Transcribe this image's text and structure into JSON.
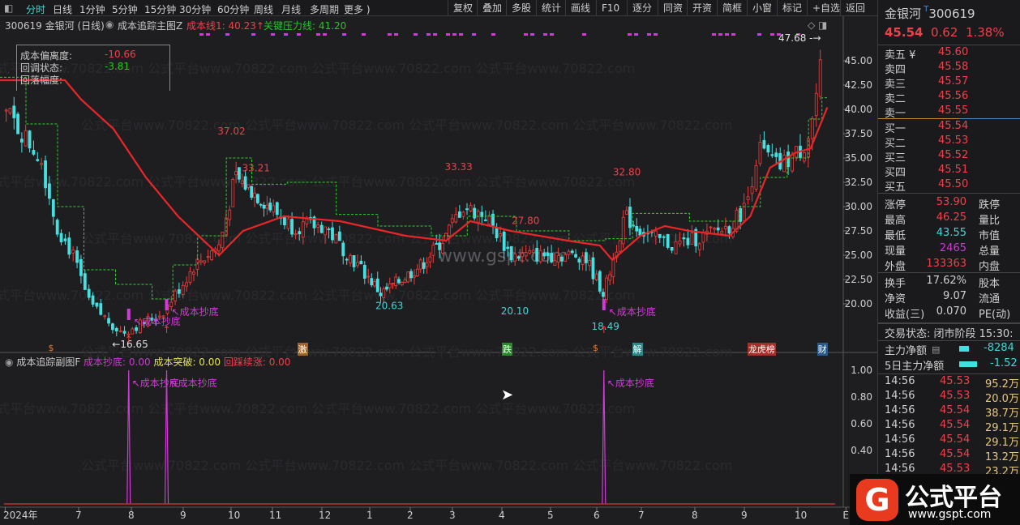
{
  "toolbar": {
    "periods": [
      "分时",
      "日线",
      "1分钟",
      "5分钟",
      "15分钟",
      "30分钟",
      "60分钟",
      "周线",
      "月线",
      "多周期",
      "更多 )"
    ],
    "buttons": [
      "复权",
      "叠加",
      "多股",
      "统计",
      "画线",
      "F10",
      "逐分",
      "同资",
      "开资",
      "简框",
      "小窗",
      "标记",
      "+自选",
      "返回"
    ]
  },
  "info": {
    "symbol": "300619 金银河 (日线)",
    "indicator": "成本追踪主图Z",
    "cost_line": "成本线1: 40.23↑",
    "key_line": "关键压力线: 41.20"
  },
  "legend": {
    "rows": [
      {
        "label": "成本偏离度:",
        "value": "-10.66"
      },
      {
        "label": "回调状态:",
        "value": "-3.81"
      },
      {
        "label": "回落幅度:",
        "value": ""
      }
    ]
  },
  "sub": {
    "title": "成本追踪副图F",
    "s1": "成本抄底: 0.00",
    "s2": "成本突破: 0.00",
    "s3": "回踩续涨: 0.00",
    "signal_label": "成本抄底"
  },
  "events": [
    {
      "m": 6.5,
      "t": "$",
      "c": "#e07a40",
      "bg": ""
    },
    {
      "m": 11.6,
      "t": "激",
      "c": "#fff",
      "bg": "#a0602a"
    },
    {
      "m": 16.1,
      "t": "跌",
      "c": "#fff",
      "bg": "#2a8a2a"
    },
    {
      "m": 18.0,
      "t": "$",
      "c": "#e07a40",
      "bg": ""
    },
    {
      "m": 18.9,
      "t": "解",
      "c": "#fff",
      "bg": "#2a8a8a"
    },
    {
      "m": 21.15,
      "t": "龙虎榜",
      "c": "#fff",
      "bg": "#a0302a"
    },
    {
      "m": 22.45,
      "t": "财",
      "c": "#fff",
      "bg": "#2a5a8a"
    }
  ],
  "chart_data": {
    "type": "candlestick",
    "x_unit": "months since 2024-01 (13 = Jan 2025)",
    "x_ticks": [
      {
        "m": 5.6,
        "label": "2024年"
      },
      {
        "m": 7,
        "label": "7"
      },
      {
        "m": 8,
        "label": "8"
      },
      {
        "m": 9,
        "label": "9"
      },
      {
        "m": 10,
        "label": "10"
      },
      {
        "m": 11,
        "label": "11"
      },
      {
        "m": 12,
        "label": "12"
      },
      {
        "m": 13,
        "label": "1"
      },
      {
        "m": 14,
        "label": "2"
      },
      {
        "m": 15,
        "label": "3"
      },
      {
        "m": 16,
        "label": "4"
      },
      {
        "m": 17,
        "label": "5"
      },
      {
        "m": 18,
        "label": "6"
      },
      {
        "m": 19,
        "label": "7"
      },
      {
        "m": 20,
        "label": "8"
      },
      {
        "m": 21,
        "label": "9"
      },
      {
        "m": 22,
        "label": "10"
      },
      {
        "m": 22.9,
        "label": "E"
      }
    ],
    "y_ticks": [
      45,
      42.5,
      40,
      37.5,
      35,
      32.5,
      30,
      27.5,
      25,
      22.5,
      20
    ],
    "y_tick_labels": [
      "45.00",
      "42.50",
      "40.00",
      "37.50",
      "35.00",
      "32.50",
      "30.00",
      "27.50",
      "25.00",
      "22.50",
      "20.00"
    ],
    "ylim": [
      14,
      49
    ],
    "close_path": [
      [
        5.58,
        40
      ],
      [
        6.28,
        35
      ],
      [
        6.58,
        28
      ],
      [
        6.89,
        25
      ],
      [
        7.2,
        20
      ],
      [
        7.82,
        17
      ],
      [
        8.59,
        19
      ],
      [
        9.24,
        24
      ],
      [
        9.75,
        26
      ],
      [
        10.1,
        33
      ],
      [
        10.69,
        31
      ],
      [
        11.39,
        28
      ],
      [
        12.05,
        28
      ],
      [
        12.56,
        25
      ],
      [
        13.28,
        21
      ],
      [
        14.27,
        24
      ],
      [
        14.85,
        27
      ],
      [
        15.2,
        30
      ],
      [
        15.69,
        29
      ],
      [
        16.18,
        25
      ],
      [
        17.02,
        25
      ],
      [
        17.72,
        25
      ],
      [
        18.16,
        21
      ],
      [
        18.62,
        29
      ],
      [
        19.14,
        27
      ],
      [
        19.59,
        26
      ],
      [
        20.21,
        27
      ],
      [
        20.7,
        28
      ],
      [
        21.03,
        30
      ],
      [
        21.26,
        36
      ],
      [
        21.64,
        34
      ],
      [
        22.09,
        36
      ],
      [
        22.24,
        38
      ],
      [
        22.47,
        45.5
      ]
    ],
    "cost_line": {
      "name": "成本线1",
      "color": "#e8262a",
      "points": [
        [
          5.5,
          43
        ],
        [
          6.74,
          43
        ],
        [
          7.05,
          41
        ],
        [
          7.66,
          38
        ],
        [
          8.28,
          33
        ],
        [
          8.9,
          29
        ],
        [
          9.75,
          25
        ],
        [
          10.29,
          27.5
        ],
        [
          11.23,
          29
        ],
        [
          12.38,
          28.5
        ],
        [
          13.88,
          27
        ],
        [
          14.85,
          26.5
        ],
        [
          15.36,
          28.5
        ],
        [
          16.18,
          27.5
        ],
        [
          17.37,
          26.5
        ],
        [
          18.07,
          26
        ],
        [
          18.35,
          24.5
        ],
        [
          18.98,
          27
        ],
        [
          19.44,
          28
        ],
        [
          19.89,
          27.5
        ],
        [
          20.7,
          27
        ],
        [
          21.11,
          29
        ],
        [
          21.48,
          34
        ],
        [
          21.94,
          35.5
        ],
        [
          22.24,
          36
        ],
        [
          22.55,
          40.2
        ]
      ]
    },
    "key_line": {
      "name": "关键压力线",
      "color": "#2fd02f",
      "steps": [
        [
          5.5,
          43.3
        ],
        [
          6.0,
          38.5
        ],
        [
          6.6,
          30
        ],
        [
          7.1,
          23.5
        ],
        [
          7.7,
          22
        ],
        [
          8.4,
          20.5
        ],
        [
          8.8,
          24
        ],
        [
          9.3,
          27
        ],
        [
          9.9,
          35
        ],
        [
          10.5,
          32.3
        ],
        [
          11.3,
          32.5
        ],
        [
          12.3,
          29.2
        ],
        [
          13.2,
          28
        ],
        [
          14.5,
          27
        ],
        [
          15.3,
          29
        ],
        [
          16.3,
          27.5
        ],
        [
          17.4,
          26.5
        ],
        [
          18.2,
          26.7
        ],
        [
          18.8,
          29.3
        ],
        [
          19.9,
          28.5
        ],
        [
          20.9,
          30
        ],
        [
          21.3,
          33
        ],
        [
          21.8,
          35
        ],
        [
          22.2,
          39
        ],
        [
          22.45,
          41.2
        ]
      ]
    },
    "annotations": [
      {
        "m": 7.82,
        "p": 16.65,
        "label": "←16.65",
        "color": "#e0e0e0"
      },
      {
        "m": 9.92,
        "p": 37.02,
        "label": "37.02",
        "color": "#f0404a"
      },
      {
        "m": 10.5,
        "p": 33.21,
        "label": "33.21",
        "color": "#f0404a"
      },
      {
        "m": 13.38,
        "p": 20.63,
        "label": "20.63",
        "color": "#3fd6d6"
      },
      {
        "m": 15.04,
        "p": 33.33,
        "label": "33.33",
        "color": "#f0404a"
      },
      {
        "m": 16.4,
        "p": 27.8,
        "label": "27.80",
        "color": "#f0404a"
      },
      {
        "m": 16.18,
        "p": 20.1,
        "label": "20.10",
        "color": "#3fd6d6"
      },
      {
        "m": 18.1,
        "p": 18.49,
        "label": "18.49",
        "color": "#3fd6d6"
      },
      {
        "m": 18.58,
        "p": 32.8,
        "label": "32.80",
        "color": "#f0404a"
      },
      {
        "m": 22.47,
        "p": 47.68,
        "label": "47.68 -→",
        "color": "#e0e0e0"
      }
    ],
    "main_signals": [
      {
        "m": 7.95,
        "p": 18.5
      },
      {
        "m": 8.68,
        "p": 19.5
      },
      {
        "m": 18.16,
        "p": 19.5
      }
    ],
    "sub_chart": {
      "y_ticks": [
        1.0,
        0.8,
        0.6,
        0.4
      ],
      "y_tick_labels": [
        "1.00",
        "0.80",
        "0.60",
        "0.40"
      ],
      "ylim": [
        0,
        1.05
      ],
      "spikes": [
        {
          "m": 7.95,
          "v": 1.0
        },
        {
          "m": 8.68,
          "v": 1.0
        },
        {
          "m": 18.16,
          "v": 1.0
        }
      ]
    }
  },
  "quote": {
    "name": "金银河",
    "code": "300619",
    "price": "45.54",
    "change": "0.62",
    "pct": "1.38%",
    "asks": [
      {
        "l": "卖五 ¥",
        "v": "45.60"
      },
      {
        "l": "卖四",
        "v": "45.58"
      },
      {
        "l": "卖三",
        "v": "45.57"
      },
      {
        "l": "卖二",
        "v": "45.56"
      },
      {
        "l": "卖一",
        "v": "45.55"
      }
    ],
    "bids": [
      {
        "l": "买一",
        "v": "45.54"
      },
      {
        "l": "买二",
        "v": "45.53"
      },
      {
        "l": "买三",
        "v": "45.52"
      },
      {
        "l": "买四",
        "v": "45.51"
      },
      {
        "l": "买五",
        "v": "45.50"
      }
    ],
    "stats": [
      {
        "l": "涨停",
        "v": "53.90",
        "c": "red",
        "r": "跌停"
      },
      {
        "l": "最高",
        "v": "46.25",
        "c": "red",
        "r": "量比"
      },
      {
        "l": "最低",
        "v": "43.55",
        "c": "cyan",
        "r": "市值"
      },
      {
        "l": "现量",
        "v": "2465",
        "c": "mag",
        "r": "总量"
      },
      {
        "l": "外盘",
        "v": "133363",
        "c": "red",
        "r": "内盘"
      }
    ],
    "stats2": [
      {
        "l": "换手",
        "v": "17.62%",
        "r": "股本"
      },
      {
        "l": "净资",
        "v": "9.07",
        "r": "流通"
      },
      {
        "l": "收益(三)",
        "v": "0.070",
        "r": "PE(动)"
      }
    ],
    "status": "交易状态: 闭市阶段 15:30:",
    "flow": [
      {
        "l": "主力净额",
        "v": "-8284"
      },
      {
        "l": "5日主力净额",
        "v": "-1.52"
      }
    ],
    "ticks": [
      {
        "t": "14:56",
        "p": "45.53",
        "v": "95.2万"
      },
      {
        "t": "14:56",
        "p": "45.53",
        "v": "20.0万"
      },
      {
        "t": "14:56",
        "p": "45.54",
        "v": "38.7万"
      },
      {
        "t": "14:56",
        "p": "45.54",
        "v": "29.1万"
      },
      {
        "t": "14:56",
        "p": "45.54",
        "v": "29.1万"
      },
      {
        "t": "14:56",
        "p": "45.54",
        "v": "13.2万"
      },
      {
        "t": "14:56",
        "p": "45.53",
        "v": "23.2万"
      }
    ]
  },
  "logo": {
    "text": "公式平台",
    "url": "www.gspt.com"
  },
  "watermark": "www.gspt.com"
}
